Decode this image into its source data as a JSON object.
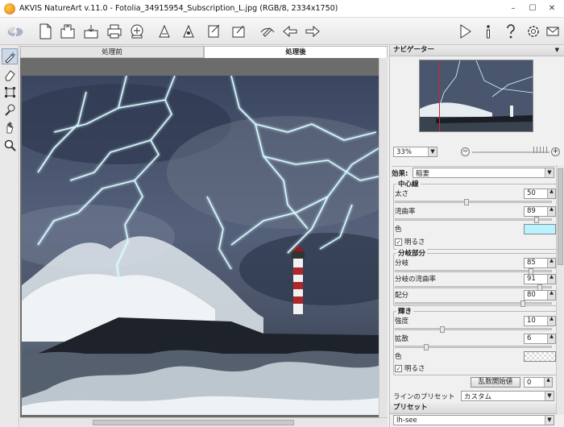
{
  "window": {
    "title": "AKVIS NatureArt v.11.0 - Fotolia_34915954_Subscription_L.jpg (RGB/8, 2334x1750)",
    "minimize": "–",
    "maximize": "☐",
    "close": "✕"
  },
  "tabs": [
    {
      "label": "処理前"
    },
    {
      "label": "処理後"
    }
  ],
  "navigator": {
    "title": "ナビゲーター",
    "zoom": "33%",
    "zoom_minus": "−",
    "zoom_plus": "+"
  },
  "effect": {
    "label": "効果:",
    "value": "稲妻"
  },
  "center_line": {
    "title": "中心線",
    "thickness_label": "太さ",
    "thickness": "50",
    "curvature_label": "湾曲率",
    "curvature": "89",
    "color_label": "色",
    "color": "#b9f3ff",
    "brightness_label": "明るさ"
  },
  "branches": {
    "title": "分岐部分",
    "branch_label": "分岐",
    "branch": "85",
    "branch_curvature_label": "分岐の湾曲率",
    "branch_curvature": "91",
    "distribution_label": "配分",
    "distribution": "80"
  },
  "glow": {
    "title": "輝き",
    "intensity_label": "強度",
    "intensity": "10",
    "spread_label": "拡散",
    "spread": "6",
    "color_label": "色",
    "brightness_label": "明るさ"
  },
  "random": {
    "button": "乱数開始値",
    "value": "0"
  },
  "line_preset": {
    "label": "ラインのプリセット",
    "value": "カスタム"
  },
  "presets": {
    "title": "プリセット",
    "value": "lh-see"
  },
  "icons": {
    "check": "✓",
    "spin_up": "▲",
    "spin_down": "▼",
    "drop": "▼"
  }
}
